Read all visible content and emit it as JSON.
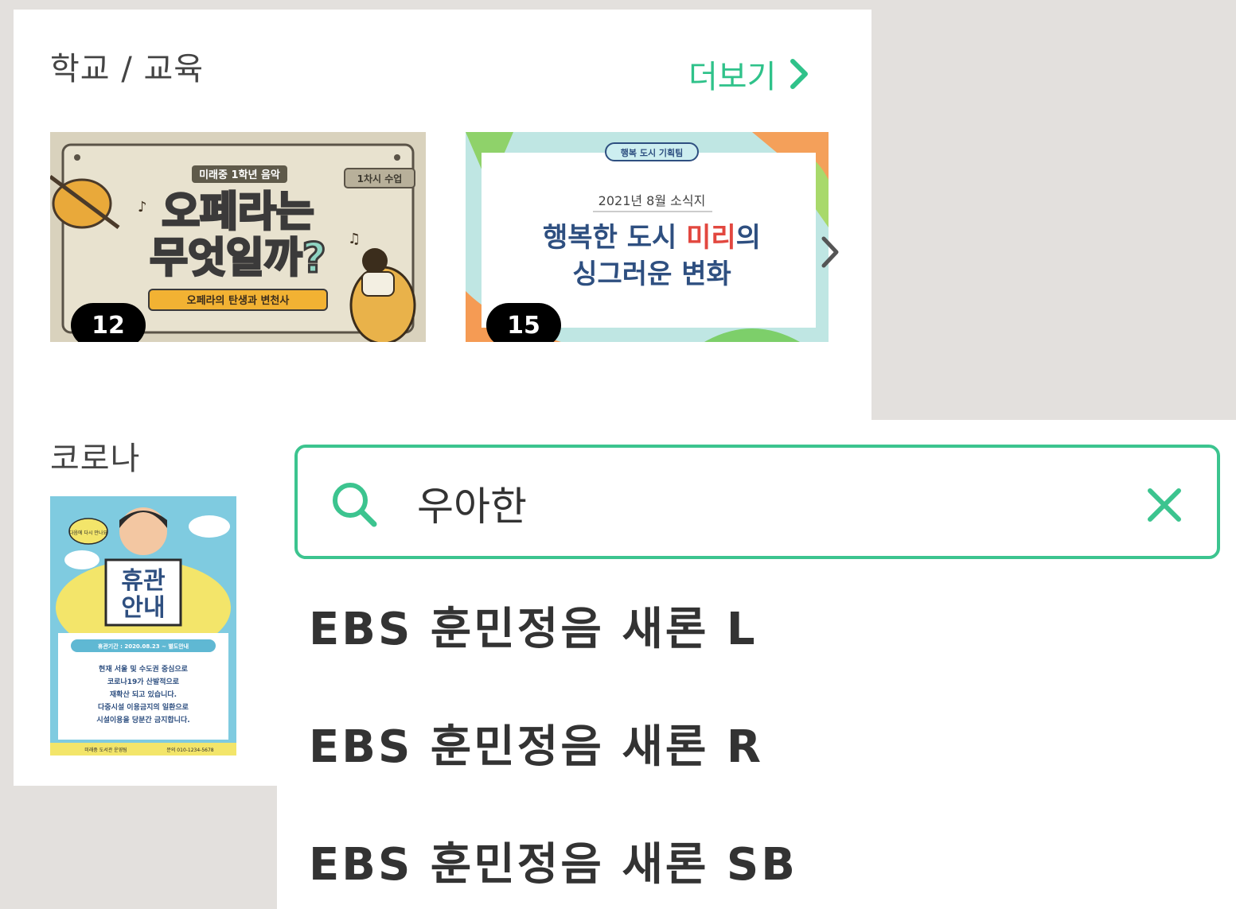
{
  "school_section": {
    "title": "학교 / 교육",
    "more_label": "더보기",
    "cards": [
      {
        "count": "12",
        "top_label": "미래중 1학년 음악",
        "tag": "1차시 수업",
        "headline_1": "오페라는",
        "headline_2": "무엇일까?",
        "subtitle": "오페라의 탄생과 변천사"
      },
      {
        "count": "15",
        "top_label": "행복 도시 기획팀",
        "date_label": "2021년 8월 소식지",
        "headline_1a": "행복한 도시 ",
        "headline_1b": "미리",
        "headline_1c": "의",
        "headline_2": "싱그러운 변화"
      }
    ]
  },
  "corona_section": {
    "title": "코로나",
    "card": {
      "bubble_text": "다음에 다시 만나요",
      "sign_line_1": "휴관",
      "sign_line_2": "안내",
      "period_text": "휴관기간 : 2020.08.23 ~ 별도안내",
      "notice_lines": [
        "현재 서울 및 수도권 중심으로",
        "코로나19가 산발적으로",
        "재확산 되고 있습니다.",
        "다중시설 이용금지의 일환으로",
        "시설이용을 당분간 금지합니다."
      ],
      "footer_left": "미래중 도서관 운영팀",
      "footer_right": "문의 010-1234-5678"
    }
  },
  "search": {
    "value": "우아한",
    "suggestions": [
      "EBS 훈민정음 새론 L",
      "EBS 훈민정음 새론 R",
      "EBS 훈민정음 새론 SB"
    ]
  },
  "colors": {
    "accent": "#2fc28a",
    "search_border": "#3cc48f",
    "badge_bg": "#000000",
    "page_bg": "#e3e0dd"
  },
  "icons": {
    "more": "chevron-right-icon",
    "carousel": "chevron-right-icon",
    "search": "search-icon",
    "clear": "close-icon"
  }
}
